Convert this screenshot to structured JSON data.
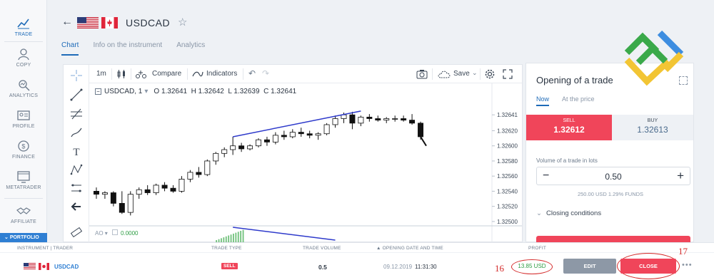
{
  "nav": {
    "items": [
      {
        "label": "TRADE",
        "icon": "trade-chart-icon",
        "active": true
      },
      {
        "label": "COPY",
        "icon": "copy-user-icon"
      },
      {
        "label": "ANALYTICS",
        "icon": "analytics-icon"
      },
      {
        "label": "PROFILE",
        "icon": "profile-card-icon"
      },
      {
        "label": "FINANCE",
        "icon": "dollar-coin-icon"
      },
      {
        "label": "METATRADER",
        "icon": "monitor-icon"
      },
      {
        "label": "AFFILIATE",
        "icon": "handshake-icon"
      }
    ],
    "portfolio_label": "PORTFOLIO"
  },
  "header": {
    "symbol": "USDCAD",
    "tabs": [
      {
        "label": "Chart",
        "active": true
      },
      {
        "label": "Info on the instrument"
      },
      {
        "label": "Analytics"
      }
    ]
  },
  "toolbar": {
    "interval": "1m",
    "compare_label": "Compare",
    "indicators_label": "Indicators",
    "save_label": "Save"
  },
  "chart": {
    "legend_symbol": "USDCAD, 1",
    "legend_o": "O 1.32641",
    "legend_h": "H 1.32642",
    "legend_l": "L 1.32639",
    "legend_c": "C 1.32641",
    "ao_label": "AO",
    "ao_value": "0.0000"
  },
  "chart_data": {
    "type": "candlestick",
    "y_ticks": [
      "1.32641",
      "1.32620",
      "1.32600",
      "1.32580",
      "1.32560",
      "1.32540",
      "1.32520",
      "1.32500"
    ],
    "ylim": [
      1.32498,
      1.3266
    ],
    "series": [
      {
        "o": 1.3254,
        "h": 1.32545,
        "l": 1.3253,
        "c": 1.32536
      },
      {
        "o": 1.32536,
        "h": 1.3254,
        "l": 1.3253,
        "c": 1.32538
      },
      {
        "o": 1.32538,
        "h": 1.3254,
        "l": 1.3252,
        "c": 1.32524
      },
      {
        "o": 1.32524,
        "h": 1.3254,
        "l": 1.3251,
        "c": 1.32512
      },
      {
        "o": 1.32512,
        "h": 1.3254,
        "l": 1.32508,
        "c": 1.32536
      },
      {
        "o": 1.32536,
        "h": 1.32545,
        "l": 1.3253,
        "c": 1.32542
      },
      {
        "o": 1.32542,
        "h": 1.32548,
        "l": 1.32535,
        "c": 1.32538
      },
      {
        "o": 1.32538,
        "h": 1.3255,
        "l": 1.32535,
        "c": 1.32548
      },
      {
        "o": 1.32548,
        "h": 1.32552,
        "l": 1.3254,
        "c": 1.32544
      },
      {
        "o": 1.32544,
        "h": 1.32548,
        "l": 1.32538,
        "c": 1.3254
      },
      {
        "o": 1.3254,
        "h": 1.3256,
        "l": 1.32538,
        "c": 1.32556
      },
      {
        "o": 1.32556,
        "h": 1.32568,
        "l": 1.32552,
        "c": 1.32565
      },
      {
        "o": 1.32565,
        "h": 1.32572,
        "l": 1.32558,
        "c": 1.32562
      },
      {
        "o": 1.32562,
        "h": 1.32582,
        "l": 1.3256,
        "c": 1.3258
      },
      {
        "o": 1.3258,
        "h": 1.32592,
        "l": 1.32575,
        "c": 1.3259
      },
      {
        "o": 1.3259,
        "h": 1.32598,
        "l": 1.32585,
        "c": 1.32595
      },
      {
        "o": 1.32595,
        "h": 1.32612,
        "l": 1.32588,
        "c": 1.326
      },
      {
        "o": 1.326,
        "h": 1.32604,
        "l": 1.32592,
        "c": 1.32596
      },
      {
        "o": 1.32596,
        "h": 1.32602,
        "l": 1.32594,
        "c": 1.326
      },
      {
        "o": 1.326,
        "h": 1.3261,
        "l": 1.32598,
        "c": 1.32608
      },
      {
        "o": 1.32608,
        "h": 1.32612,
        "l": 1.326,
        "c": 1.32605
      },
      {
        "o": 1.32605,
        "h": 1.32618,
        "l": 1.32602,
        "c": 1.32614
      },
      {
        "o": 1.32614,
        "h": 1.3262,
        "l": 1.32608,
        "c": 1.32612
      },
      {
        "o": 1.32612,
        "h": 1.32622,
        "l": 1.3261,
        "c": 1.32618
      },
      {
        "o": 1.32618,
        "h": 1.32624,
        "l": 1.32612,
        "c": 1.32616
      },
      {
        "o": 1.32616,
        "h": 1.3262,
        "l": 1.3261,
        "c": 1.32614
      },
      {
        "o": 1.32614,
        "h": 1.32618,
        "l": 1.32608,
        "c": 1.32616
      },
      {
        "o": 1.32616,
        "h": 1.3263,
        "l": 1.32614,
        "c": 1.32628
      },
      {
        "o": 1.32628,
        "h": 1.3264,
        "l": 1.32624,
        "c": 1.32636
      },
      {
        "o": 1.32636,
        "h": 1.32644,
        "l": 1.3263,
        "c": 1.32641
      },
      {
        "o": 1.32641,
        "h": 1.32645,
        "l": 1.32622,
        "c": 1.3263
      },
      {
        "o": 1.3263,
        "h": 1.3264,
        "l": 1.32626,
        "c": 1.32638
      },
      {
        "o": 1.32638,
        "h": 1.32642,
        "l": 1.32632,
        "c": 1.32636
      },
      {
        "o": 1.32636,
        "h": 1.3264,
        "l": 1.32632,
        "c": 1.32634
      },
      {
        "o": 1.32634,
        "h": 1.32638,
        "l": 1.3263,
        "c": 1.32636
      },
      {
        "o": 1.32636,
        "h": 1.3264,
        "l": 1.32632,
        "c": 1.32636
      },
      {
        "o": 1.32636,
        "h": 1.3264,
        "l": 1.32632,
        "c": 1.32634
      },
      {
        "o": 1.32634,
        "h": 1.32642,
        "l": 1.32628,
        "c": 1.3263
      },
      {
        "o": 1.3263,
        "h": 1.32632,
        "l": 1.32608,
        "c": 1.32612
      }
    ]
  },
  "trade": {
    "title": "Opening of a trade",
    "tab_now": "Now",
    "tab_price": "At the price",
    "sell_label": "SELL",
    "sell_price": "1.32612",
    "buy_label": "BUY",
    "buy_price": "1.32613",
    "volume_label": "Volume of a trade in lots",
    "volume": "0.50",
    "minus": "−",
    "plus": "+",
    "volume_info": "250.00 USD   1.29% FUNDS",
    "closing_label": "Closing conditions"
  },
  "table": {
    "headers": {
      "instrument": "INSTRUMENT | TRADER",
      "trade_type": "TRADE TYPE",
      "trade_volume": "TRADE VOLUME",
      "open_date": "▲ OPENING DATE AND TIME",
      "profit": "PROFIT"
    },
    "row": {
      "instrument": "USDCAD",
      "type": "SELL",
      "volume": "0.5",
      "date": "09.12.2019",
      "time": "11:31:30",
      "profit": "13.85 USD",
      "edit_label": "EDIT",
      "close_label": "CLOSE",
      "more": "•••"
    }
  },
  "annotations": {
    "a16": "16",
    "a17": "17"
  },
  "colors": {
    "accent": "#1e6bb8",
    "sell": "#f0455a",
    "buy_bg": "#eef1f5",
    "profit": "#2e9d44",
    "annotation": "#d42a2a"
  }
}
